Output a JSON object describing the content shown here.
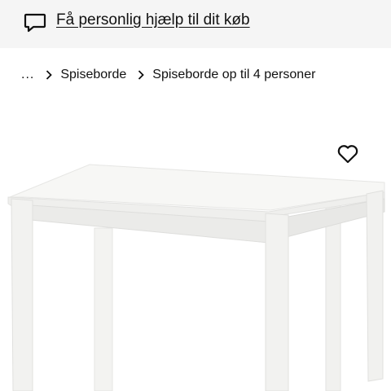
{
  "help_banner": {
    "link_text": "Få personlig hjælp til dit køb",
    "icon": "chat-bubble-icon"
  },
  "breadcrumb": {
    "ellipsis": "...",
    "items": [
      {
        "label": "Spiseborde"
      },
      {
        "label": "Spiseborde op til 4 personer"
      }
    ],
    "separator_icon": "chevron-right-icon"
  },
  "product": {
    "favourite_icon": "heart-outline-icon",
    "image_subject": "white-rectangular-dining-table"
  },
  "colors": {
    "banner_bg": "#f5f5f5",
    "text": "#111111",
    "background": "#ffffff"
  }
}
